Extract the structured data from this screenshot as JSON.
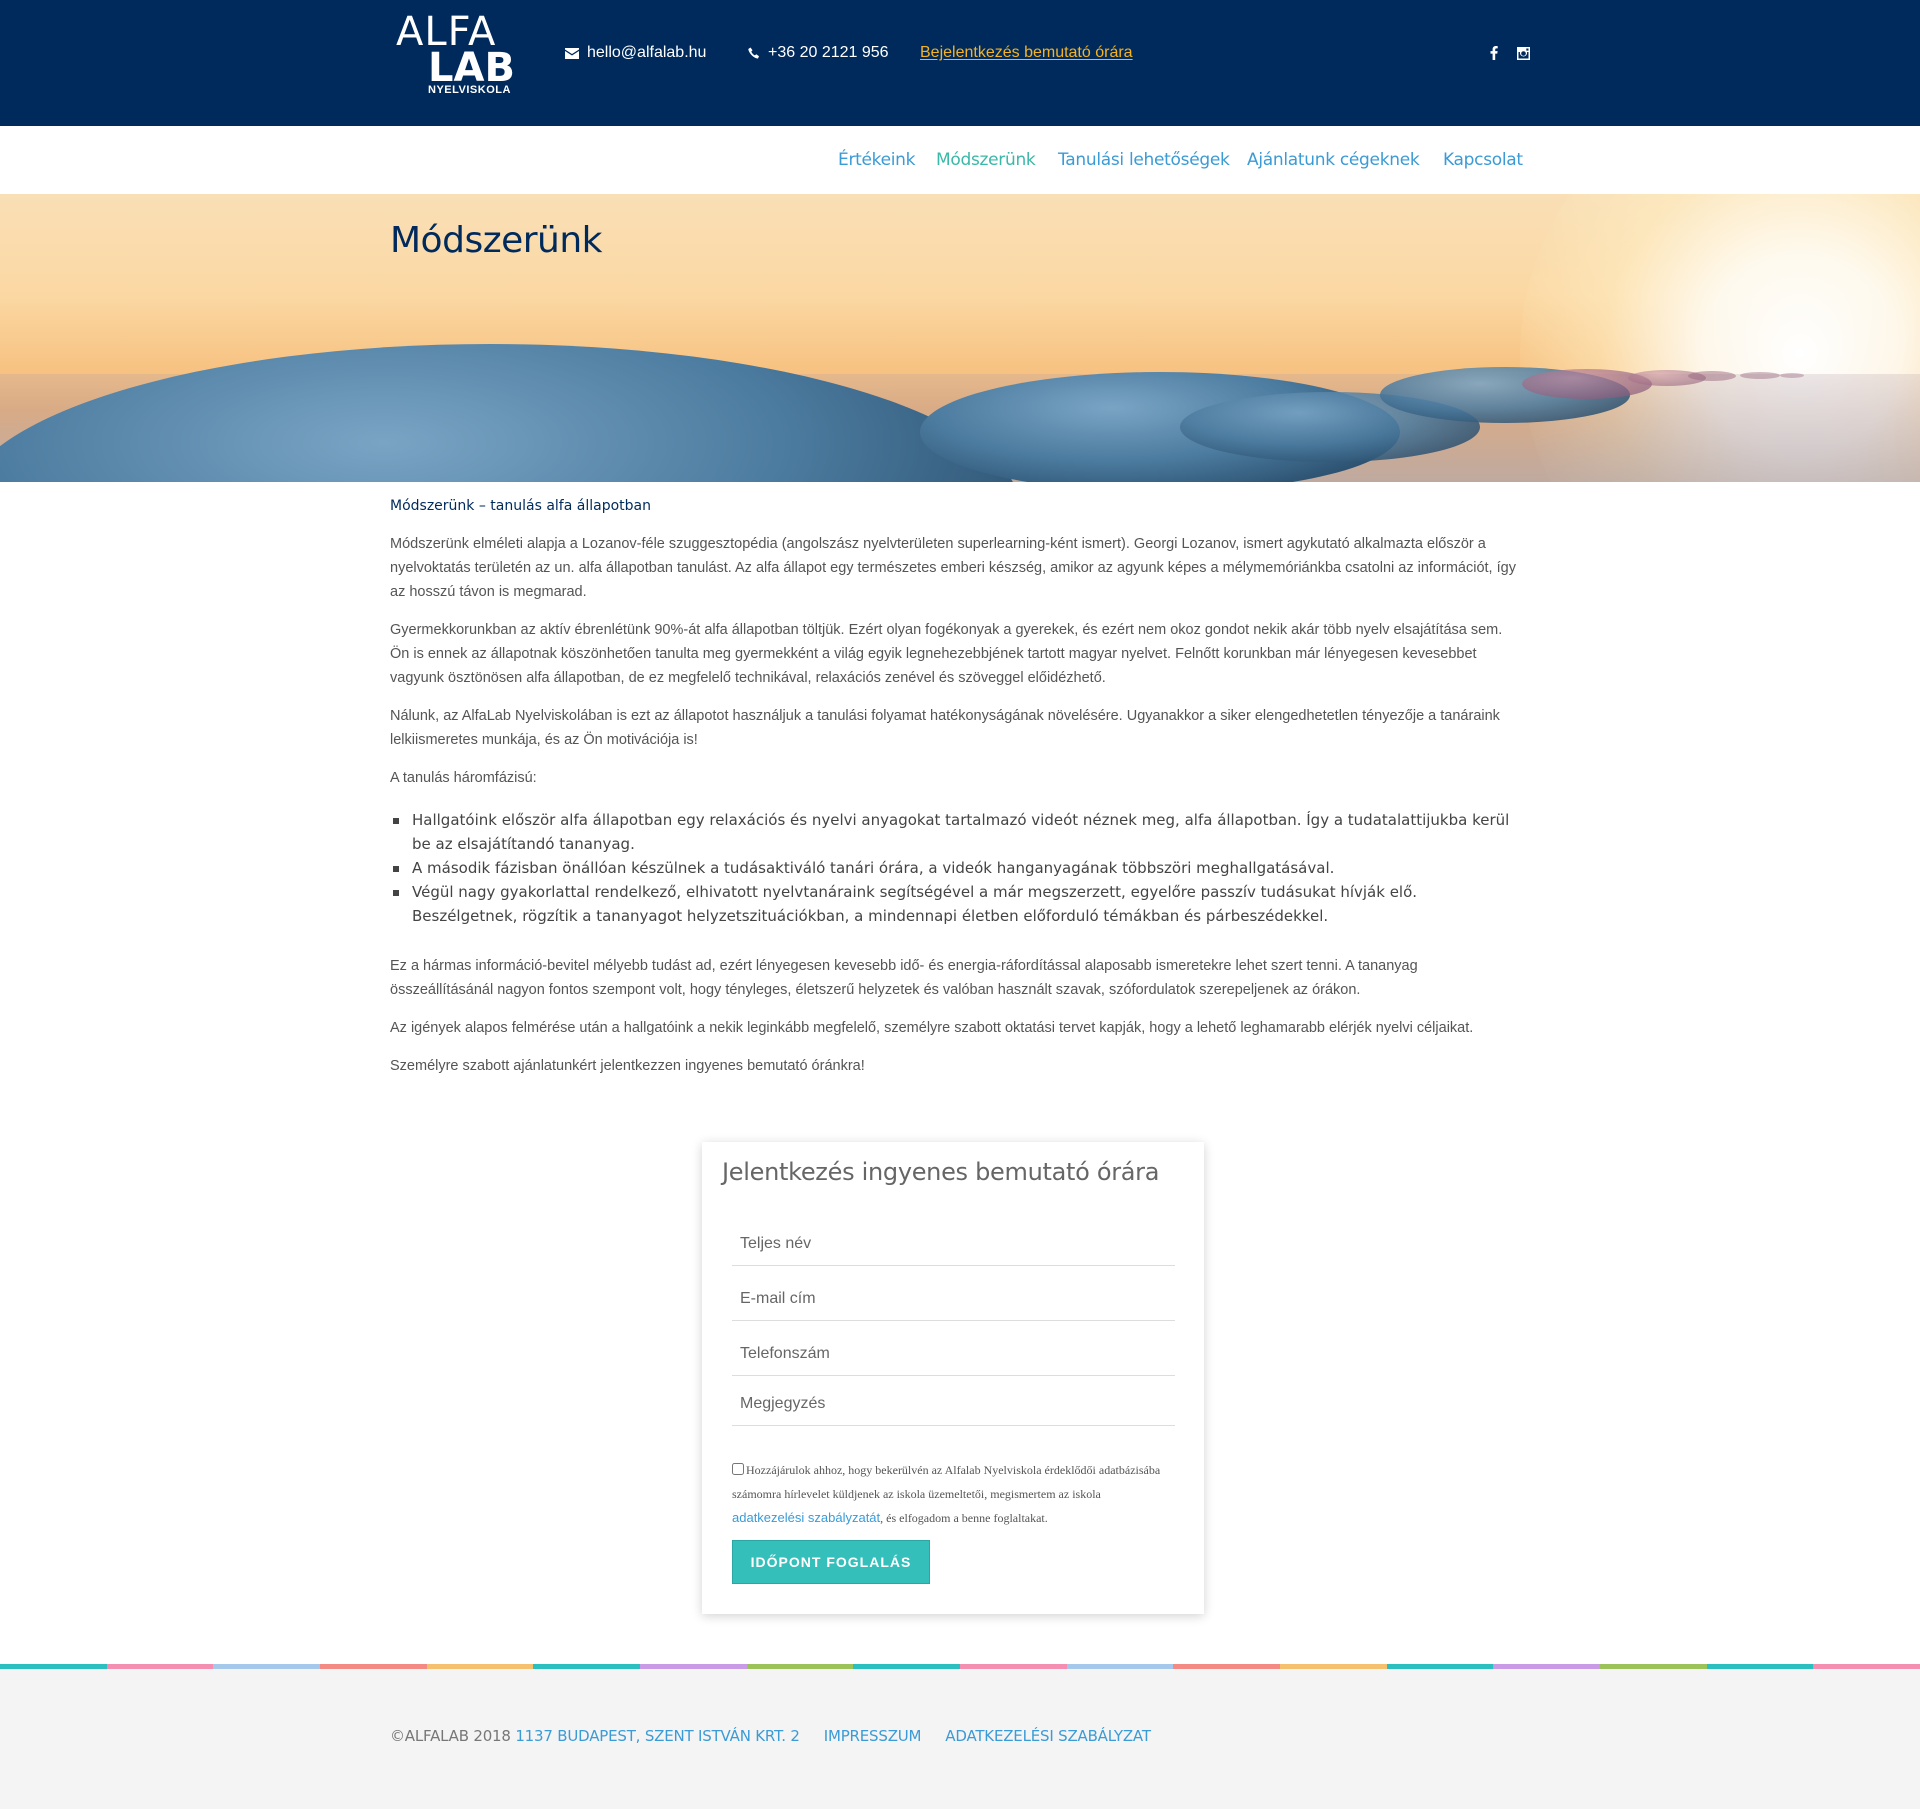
{
  "header": {
    "logo": {
      "line1": "ALFA",
      "line2": "LAB",
      "line3": "NYELVISKOLA"
    },
    "email": "hello@alfalab.hu",
    "phone": "+36 20 2121 956",
    "trial_link": "Bejelentkezés bemutató órára",
    "social": [
      "facebook-icon",
      "instagram-icon"
    ]
  },
  "nav": {
    "items": [
      {
        "label": "Értékeink",
        "active": false
      },
      {
        "label": "Módszerünk",
        "active": true
      },
      {
        "label": "Tanulási lehetőségek",
        "active": false
      },
      {
        "label": "Ajánlatunk cégeknek",
        "active": false
      },
      {
        "label": "Kapcsolat",
        "active": false
      }
    ]
  },
  "hero": {
    "title": "Módszerünk"
  },
  "content": {
    "subtitle": "Módszerünk – tanulás alfa állapotban",
    "p1": "Módszerünk elméleti alapja a Lozanov-féle szuggesztopédia (angolszász nyelvterületen superlearning-ként ismert). Georgi Lozanov, ismert agykutató alkalmazta először a nyelvoktatás területén az un. alfa állapotban tanulást. Az alfa állapot egy természetes emberi készség, amikor az agyunk képes a mélymemóriánkba csatolni az információt, így az hosszú távon is megmarad.",
    "p2": "Gyermekkorunkban az aktív ébrenlétünk 90%-át alfa állapotban töltjük. Ezért olyan fogékonyak a gyerekek, és ezért nem okoz gondot nekik akár több nyelv elsajátítása sem. Ön is ennek az állapotnak köszönhetően tanulta meg gyermekként a világ egyik legnehezebbjének tartott magyar nyelvet. Felnőtt korunkban már lényegesen kevesebbet vagyunk ösztönösen alfa állapotban, de ez megfelelő technikával, relaxációs zenével és szöveggel előidézhető.",
    "p3": "Nálunk, az AlfaLab Nyelviskolában is ezt az állapotot használjuk a tanulási folyamat hatékonyságának növelésére. Ugyanakkor a siker elengedhetetlen tényezője a tanáraink lelkiismeretes munkája, és az Ön motivációja is!",
    "p4": "A tanulás háromfázisú:",
    "list": [
      "Hallgatóink először alfa állapotban egy relaxációs és nyelvi anyagokat tartalmazó videót néznek meg, alfa állapotban. Így a tudatalattijukba kerül be az elsajátítandó tananyag.",
      "A második fázisban önállóan készülnek a tudásaktiváló tanári órára, a videók hanganyagának többszöri meghallgatásával.",
      "Végül nagy gyakorlattal rendelkező, elhivatott nyelvtanáraink segítségével a már megszerzett, egyelőre passzív tudásukat hívják elő. Beszélgetnek, rögzítik a tananyagot helyzetszituációkban, a mindennapi életben előforduló témákban és párbeszédekkel."
    ],
    "p5": "Ez a hármas információ-bevitel mélyebb tudást ad, ezért lényegesen kevesebb idő- és energia-ráfordítással alaposabb ismeretekre lehet szert tenni. A tananyag összeállításánál nagyon fontos szempont volt, hogy tényleges, életszerű helyzetek és valóban használt szavak, szófordulatok szerepeljenek az órákon.",
    "p6": "Az igények alapos felmérése után a hallgatóink a nekik leginkább megfelelő, személyre szabott oktatási tervet kapják, hogy a lehető leghamarabb elérjék nyelvi céljaikat.",
    "p7": "Személyre szabott ajánlatunkért jelentkezzen ingyenes bemutató óránkra!"
  },
  "form": {
    "title": "Jelentkezés ingyenes bemutató órára",
    "name_placeholder": "Teljes név",
    "email_placeholder": "E-mail cím",
    "phone_placeholder": "Telefonszám",
    "note_placeholder": "Megjegyzés",
    "consent_text_1": "Hozzájárulok ahhoz, hogy bekerülvén az Alfalab Nyelviskola érdeklődői adatbázisába számomra hírlevelet küldjenek az iskola üzemeltetői, megismertem az iskola ",
    "consent_link": "adatkezelési szabályzatát",
    "consent_text_2": ", és elfogadom a benne foglaltakat.",
    "submit": "IDŐPONT FOGLALÁS"
  },
  "footer": {
    "copyright": "©ALFALAB 2018",
    "address": "1137 BUDAPEST, SZENT ISTVÁN KRT. 2",
    "impressum": "IMPRESSZUM",
    "privacy": "ADATKEZELÉSI SZABÁLYZAT",
    "stripe_colors": [
      "#2bbfbf",
      "#f48fb1",
      "#a6c8ea",
      "#f48a84",
      "#f5c06f",
      "#2bbfbf",
      "#c99be6",
      "#9cc25a",
      "#2bbfbf",
      "#f48fb1",
      "#a6c8ea",
      "#f48a84",
      "#f5c06f",
      "#2bbfbf",
      "#c99be6",
      "#9cc25a",
      "#2bbfbf",
      "#f48fb1"
    ]
  },
  "colors": {
    "header_bg": "#002a5c",
    "accent": "#3a9bd6",
    "active": "#3ab8a8",
    "trial": "#f5b324",
    "button": "#35bfbb"
  }
}
